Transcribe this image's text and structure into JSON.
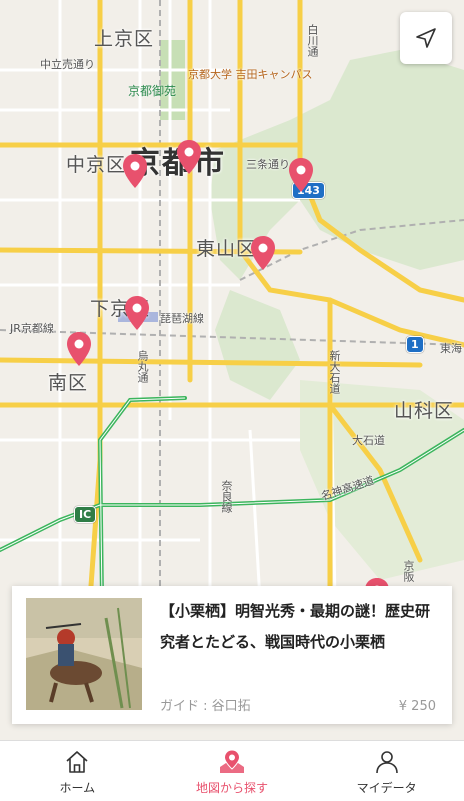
{
  "map": {
    "city_label": "京都市",
    "wards": [
      "上京区",
      "中京区",
      "東山区",
      "下京区",
      "南区",
      "山科区"
    ],
    "places": {
      "university": "京都大学 吉田キャンパス",
      "park": "京都御苑",
      "street_nakadachiuri": "中立売通り",
      "street_sanjo": "三条通り",
      "street_shirakawa": "白川通",
      "street_shin_oishi": "新大石道",
      "street_oishi": "大石道",
      "line_jr": "JR京都線",
      "line_biwako": "琵琶湖線",
      "line_tokaido": "東海",
      "line_meishin": "名神高速道",
      "street_karasuma": "烏丸通",
      "street_nara": "奈良線",
      "line_keihan": "京阪",
      "ic_label": "IC"
    },
    "route_shields": [
      "143",
      "1"
    ]
  },
  "locate_button": {
    "icon": "location-arrow-icon"
  },
  "tour_card": {
    "title": "【小栗栖】明智光秀・最期の謎！歴史研究者とたどる、戦国時代の小栗栖",
    "guide": "ガイド : 谷口拓",
    "price": "¥ 250"
  },
  "tabbar": {
    "tabs": [
      {
        "label": "ホーム",
        "icon": "home-icon"
      },
      {
        "label": "地図から探す",
        "icon": "map-pin-icon"
      },
      {
        "label": "マイデータ",
        "icon": "person-icon"
      }
    ],
    "active_color": "#e8516d"
  }
}
